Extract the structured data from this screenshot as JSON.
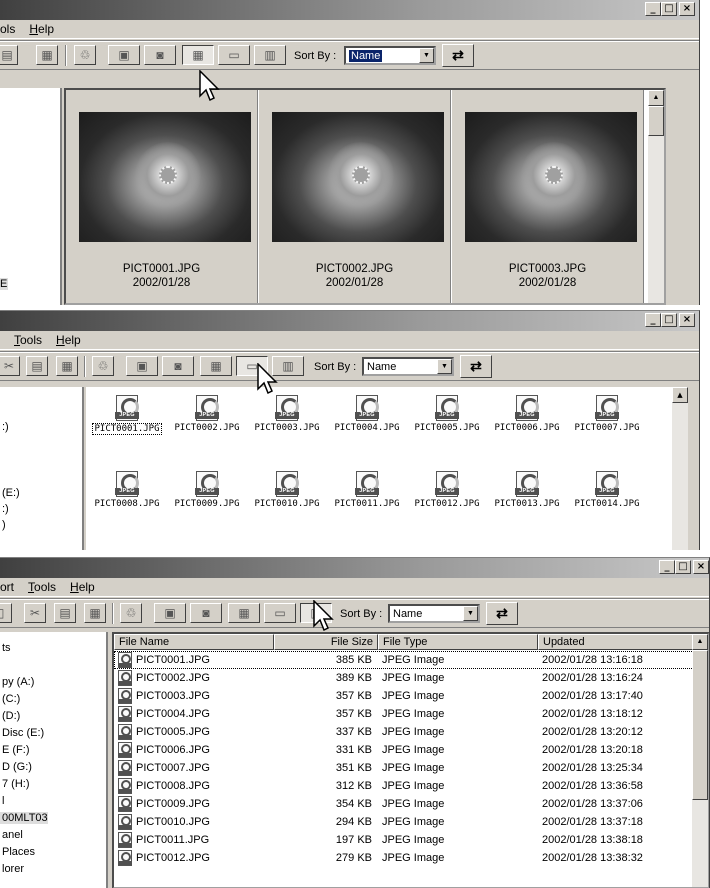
{
  "window1": {
    "menu": [
      "ols",
      "Help"
    ],
    "sort_label": "Sort By :",
    "sort_value": "Name",
    "tree_letter": "E",
    "thumbnails": [
      {
        "name": "PICT0001.JPG",
        "date": "2002/01/28"
      },
      {
        "name": "PICT0002.JPG",
        "date": "2002/01/28"
      },
      {
        "name": "PICT0003.JPG",
        "date": "2002/01/28"
      }
    ]
  },
  "window2": {
    "menu": [
      "Tools",
      "Help"
    ],
    "sort_label": "Sort By :",
    "sort_value": "Name",
    "tree": [
      ":)",
      "(E:)",
      ":)",
      ")"
    ],
    "files_row1": [
      "PICT0001.JPG",
      "PICT0002.JPG",
      "PICT0003.JPG",
      "PICT0004.JPG",
      "PICT0005.JPG",
      "PICT0006.JPG",
      "PICT0007.JPG"
    ],
    "files_row2": [
      "PICT0008.JPG",
      "PICT0009.JPG",
      "PICT0010.JPG",
      "PICT0011.JPG",
      "PICT0012.JPG",
      "PICT0013.JPG",
      "PICT0014.JPG"
    ]
  },
  "window3": {
    "menu": [
      "ort",
      "Tools",
      "Help"
    ],
    "sort_label": "Sort By :",
    "sort_value": "Name",
    "tree": [
      "ts",
      "",
      "py (A:)",
      " (C:)",
      " (D:)",
      "Disc (E:)",
      "E (F:)",
      "D (G:)",
      "7 (H:)",
      "l",
      "00MLT03",
      "anel",
      "Places",
      "lorer"
    ],
    "columns": {
      "name": "File Name",
      "size": "File Size",
      "type": "File Type",
      "updated": "Updated"
    },
    "rows": [
      {
        "name": "PICT0001.JPG",
        "size": "385 KB",
        "type": "JPEG Image",
        "updated": "2002/01/28 13:16:18"
      },
      {
        "name": "PICT0002.JPG",
        "size": "389 KB",
        "type": "JPEG Image",
        "updated": "2002/01/28 13:16:24"
      },
      {
        "name": "PICT0003.JPG",
        "size": "357 KB",
        "type": "JPEG Image",
        "updated": "2002/01/28 13:17:40"
      },
      {
        "name": "PICT0004.JPG",
        "size": "357 KB",
        "type": "JPEG Image",
        "updated": "2002/01/28 13:18:12"
      },
      {
        "name": "PICT0005.JPG",
        "size": "337 KB",
        "type": "JPEG Image",
        "updated": "2002/01/28 13:20:12"
      },
      {
        "name": "PICT0006.JPG",
        "size": "331 KB",
        "type": "JPEG Image",
        "updated": "2002/01/28 13:20:18"
      },
      {
        "name": "PICT0007.JPG",
        "size": "351 KB",
        "type": "JPEG Image",
        "updated": "2002/01/28 13:25:34"
      },
      {
        "name": "PICT0008.JPG",
        "size": "312 KB",
        "type": "JPEG Image",
        "updated": "2002/01/28 13:36:58"
      },
      {
        "name": "PICT0009.JPG",
        "size": "354 KB",
        "type": "JPEG Image",
        "updated": "2002/01/28 13:37:06"
      },
      {
        "name": "PICT0010.JPG",
        "size": "294 KB",
        "type": "JPEG Image",
        "updated": "2002/01/28 13:37:18"
      },
      {
        "name": "PICT0011.JPG",
        "size": "197 KB",
        "type": "JPEG Image",
        "updated": "2002/01/28 13:38:18"
      },
      {
        "name": "PICT0012.JPG",
        "size": "279 KB",
        "type": "JPEG Image",
        "updated": "2002/01/28 13:38:32"
      }
    ]
  },
  "icons": {
    "minimize": "_",
    "maximize": "□",
    "close": "×",
    "scroll_up": "▲",
    "dropdown": "▼",
    "swap": "⇄"
  }
}
